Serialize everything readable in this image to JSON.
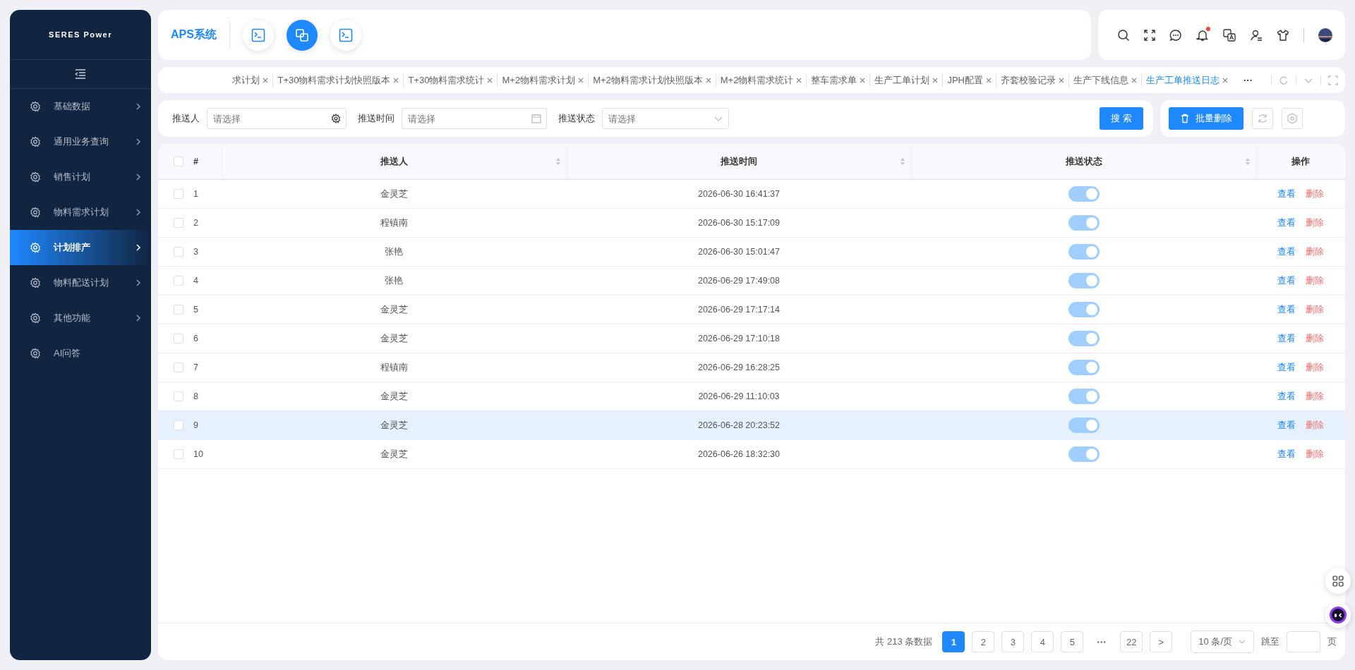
{
  "sidebar": {
    "logo": "SERES Power",
    "items": [
      {
        "label": "基础数据",
        "selected": false,
        "expandable": true
      },
      {
        "label": "通用业务查询",
        "selected": false,
        "expandable": true
      },
      {
        "label": "销售计划",
        "selected": false,
        "expandable": true
      },
      {
        "label": "物料需求计划",
        "selected": false,
        "expandable": true
      },
      {
        "label": "计划排产",
        "selected": true,
        "expandable": true
      },
      {
        "label": "物料配送计划",
        "selected": false,
        "expandable": true
      },
      {
        "label": "其他功能",
        "selected": false,
        "expandable": true
      },
      {
        "label": "AI问答",
        "selected": false,
        "expandable": false
      }
    ]
  },
  "header": {
    "title": "APS系统",
    "apps": [
      {
        "selected": false
      },
      {
        "selected": true
      },
      {
        "selected": false
      }
    ],
    "notification_dot": true
  },
  "tabs": [
    {
      "label": "求计划",
      "selected": false
    },
    {
      "label": "T+30物料需求计划快照版本",
      "selected": false
    },
    {
      "label": "T+30物料需求统计",
      "selected": false
    },
    {
      "label": "M+2物料需求计划",
      "selected": false
    },
    {
      "label": "M+2物料需求计划快照版本",
      "selected": false
    },
    {
      "label": "M+2物料需求统计",
      "selected": false
    },
    {
      "label": "整车需求单",
      "selected": false
    },
    {
      "label": "生产工单计划",
      "selected": false
    },
    {
      "label": "JPH配置",
      "selected": false
    },
    {
      "label": "齐套校验记录",
      "selected": false
    },
    {
      "label": "生产下线信息",
      "selected": false
    },
    {
      "label": "生产工单推送日志",
      "selected": true
    }
  ],
  "tabs_more": "···",
  "filters": [
    {
      "label": "推送人",
      "placeholder": "请选择",
      "kind": "person"
    },
    {
      "label": "推送时间",
      "placeholder": "请选择",
      "kind": "date"
    },
    {
      "label": "推送状态",
      "placeholder": "请选择",
      "kind": "select"
    }
  ],
  "search_button": "搜 索",
  "batch_delete_button": "批量删除",
  "table": {
    "all_checked": false,
    "columns": [
      {
        "label": "#",
        "sortable": false
      },
      {
        "label": "推送人",
        "sortable": true
      },
      {
        "label": "推送时间",
        "sortable": true
      },
      {
        "label": "推送状态",
        "sortable": true
      },
      {
        "label": "操作",
        "sortable": false
      }
    ],
    "rows": [
      {
        "index": "1",
        "person": "金灵芝",
        "time": "2026-06-30 16:41:37",
        "on": true,
        "checked": false,
        "highlighted": false,
        "view": "查看",
        "delete": "删除"
      },
      {
        "index": "2",
        "person": "程镇南",
        "time": "2026-06-30 15:17:09",
        "on": true,
        "checked": false,
        "highlighted": false,
        "view": "查看",
        "delete": "删除"
      },
      {
        "index": "3",
        "person": "张艳",
        "time": "2026-06-30 15:01:47",
        "on": true,
        "checked": false,
        "highlighted": false,
        "view": "查看",
        "delete": "删除"
      },
      {
        "index": "4",
        "person": "张艳",
        "time": "2026-06-29 17:49:08",
        "on": true,
        "checked": false,
        "highlighted": false,
        "view": "查看",
        "delete": "删除"
      },
      {
        "index": "5",
        "person": "金灵芝",
        "time": "2026-06-29 17:17:14",
        "on": true,
        "checked": false,
        "highlighted": false,
        "view": "查看",
        "delete": "删除"
      },
      {
        "index": "6",
        "person": "金灵芝",
        "time": "2026-06-29 17:10:18",
        "on": true,
        "checked": false,
        "highlighted": false,
        "view": "查看",
        "delete": "删除"
      },
      {
        "index": "7",
        "person": "程镇南",
        "time": "2026-06-29 16:28:25",
        "on": true,
        "checked": false,
        "highlighted": false,
        "view": "查看",
        "delete": "删除"
      },
      {
        "index": "8",
        "person": "金灵芝",
        "time": "2026-06-29 11:10:03",
        "on": true,
        "checked": false,
        "highlighted": false,
        "view": "查看",
        "delete": "删除"
      },
      {
        "index": "9",
        "person": "金灵芝",
        "time": "2026-06-28 20:23:52",
        "on": true,
        "checked": false,
        "highlighted": true,
        "view": "查看",
        "delete": "删除"
      },
      {
        "index": "10",
        "person": "金灵芝",
        "time": "2026-06-26 18:32:30",
        "on": true,
        "checked": false,
        "highlighted": false,
        "view": "查看",
        "delete": "删除"
      }
    ]
  },
  "pagination": {
    "total": "共 213 条数据",
    "pages": [
      {
        "label": "1",
        "kind": "page",
        "selected": true
      },
      {
        "label": "2",
        "kind": "page",
        "selected": false
      },
      {
        "label": "3",
        "kind": "page",
        "selected": false
      },
      {
        "label": "4",
        "kind": "page",
        "selected": false
      },
      {
        "label": "5",
        "kind": "page",
        "selected": false
      },
      {
        "label": "•••",
        "kind": "ellipsis"
      },
      {
        "label": "22",
        "kind": "page",
        "selected": false
      }
    ],
    "next": ">",
    "page_size": "10 条/页",
    "jump_label": "跳至",
    "jump_suffix": "页"
  }
}
